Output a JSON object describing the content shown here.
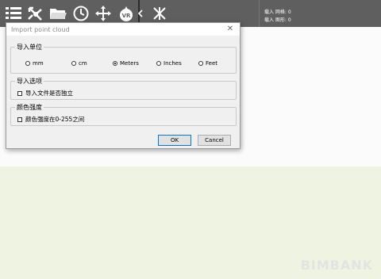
{
  "toolbar": {
    "icons": [
      "menu-icon",
      "move-icon",
      "folder-icon",
      "clock-icon",
      "pan-icon",
      "vr-icon",
      "collapse-arrow-icon",
      "cursor-icon"
    ],
    "vr_label": "VR",
    "info_line1": "载入 网格: 0",
    "info_line2": "载入 图形: 0"
  },
  "dialog": {
    "title": "Import point cloud",
    "units": {
      "legend": "导入单位",
      "options": [
        "mm",
        "cm",
        "Meters",
        "Inches",
        "Feet"
      ],
      "selected": "Meters"
    },
    "import_options": {
      "legend": "导入选项",
      "checkbox_label": "导入文件是否独立",
      "checked": false
    },
    "color_intensity": {
      "legend": "颜色强度",
      "checkbox_label": "颜色强度在0-255之间",
      "checked": false
    },
    "ok_label": "OK",
    "cancel_label": "Cancel"
  },
  "watermark": "BIMBANK",
  "colors": {
    "toolbar_bg": "#5f5f5f",
    "canvas_bottom": "#eef3e2",
    "dialog_body": "#f0f0f0"
  }
}
